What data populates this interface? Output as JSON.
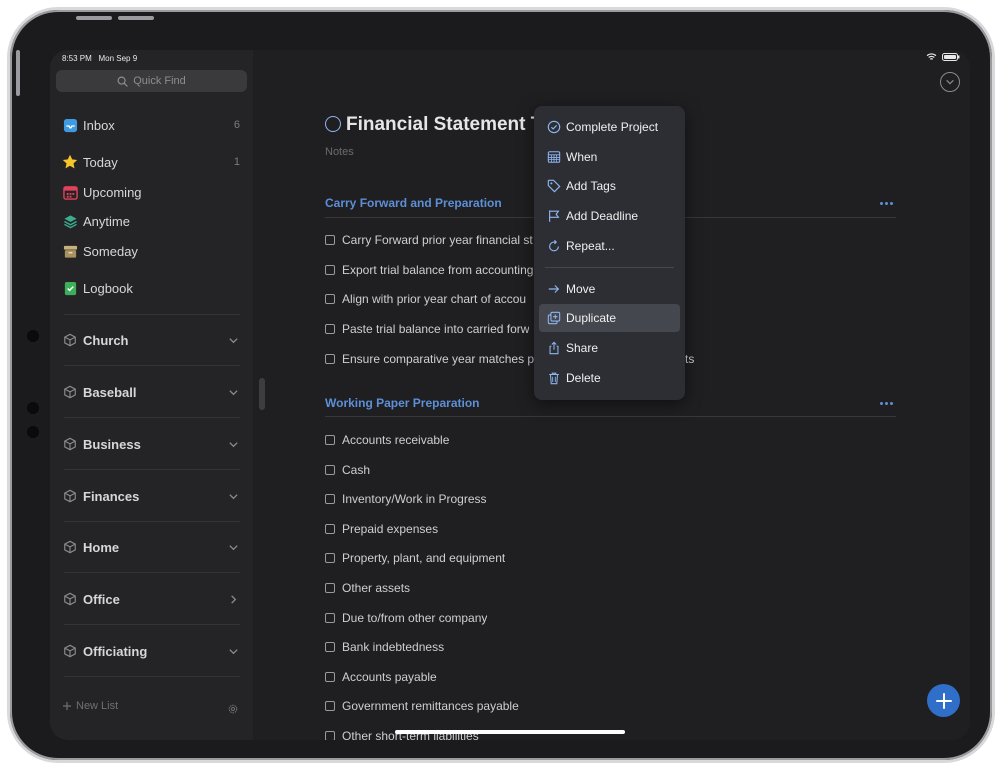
{
  "status": {
    "time": "8:53 PM",
    "date": "Mon Sep 9"
  },
  "quick_find": {
    "placeholder": "Quick Find"
  },
  "sidebar": {
    "nav": [
      {
        "label": "Inbox",
        "count": "6",
        "icon": "inbox-icon",
        "color": "#3f9be0"
      },
      {
        "label": "Today",
        "count": "1",
        "icon": "star-icon",
        "color": "#f5c52b"
      },
      {
        "label": "Upcoming",
        "count": "",
        "icon": "calendar-icon",
        "color": "#e0415b"
      },
      {
        "label": "Anytime",
        "count": "",
        "icon": "layers-icon",
        "color": "#3dab8e"
      },
      {
        "label": "Someday",
        "count": "",
        "icon": "archive-box-icon",
        "color": "#c9b27a"
      },
      {
        "label": "Logbook",
        "count": "",
        "icon": "logbook-icon",
        "color": "#3fae5a"
      }
    ],
    "areas": [
      {
        "label": "Church",
        "chevron": "down"
      },
      {
        "label": "Baseball",
        "chevron": "down"
      },
      {
        "label": "Business",
        "chevron": "down"
      },
      {
        "label": "Finances",
        "chevron": "down"
      },
      {
        "label": "Home",
        "chevron": "down"
      },
      {
        "label": "Office",
        "chevron": "right"
      },
      {
        "label": "Officiating",
        "chevron": "down"
      }
    ],
    "new_list": "New List"
  },
  "project": {
    "title": "Financial Statement Te",
    "notes_placeholder": "Notes",
    "sections": [
      {
        "heading": "Carry Forward and Preparation",
        "tasks": [
          "Carry Forward prior year financial st",
          "Export trial balance from accounting",
          "Align with prior year chart of accou",
          "Paste trial balance into carried forw",
          "Ensure comparative year matches p"
        ]
      },
      {
        "heading": "Working Paper Preparation",
        "tasks": [
          "Accounts receivable",
          "Cash",
          "Inventory/Work in Progress",
          "Prepaid expenses",
          "Property, plant, and equipment",
          "Other assets",
          "Due to/from other company",
          "Bank indebtedness",
          "Accounts payable",
          "Government remittances payable",
          "Other short-term liabilities"
        ]
      }
    ],
    "partial_text": "ts"
  },
  "context_menu": {
    "items": [
      {
        "label": "Complete Project",
        "icon": "check-circle-icon"
      },
      {
        "label": "When",
        "icon": "calendar-grid-icon"
      },
      {
        "label": "Add Tags",
        "icon": "tag-icon"
      },
      {
        "label": "Add Deadline",
        "icon": "flag-icon"
      },
      {
        "label": "Repeat...",
        "icon": "repeat-icon"
      },
      {
        "label": "Move",
        "icon": "arrow-right-icon"
      },
      {
        "label": "Duplicate",
        "icon": "duplicate-icon",
        "selected": true
      },
      {
        "label": "Share",
        "icon": "share-icon"
      },
      {
        "label": "Delete",
        "icon": "trash-icon"
      }
    ]
  },
  "colors": {
    "accent": "#5d8fd8",
    "fab": "#2f6fc9",
    "background": "#1f1f21",
    "sidebar": "#242427"
  }
}
